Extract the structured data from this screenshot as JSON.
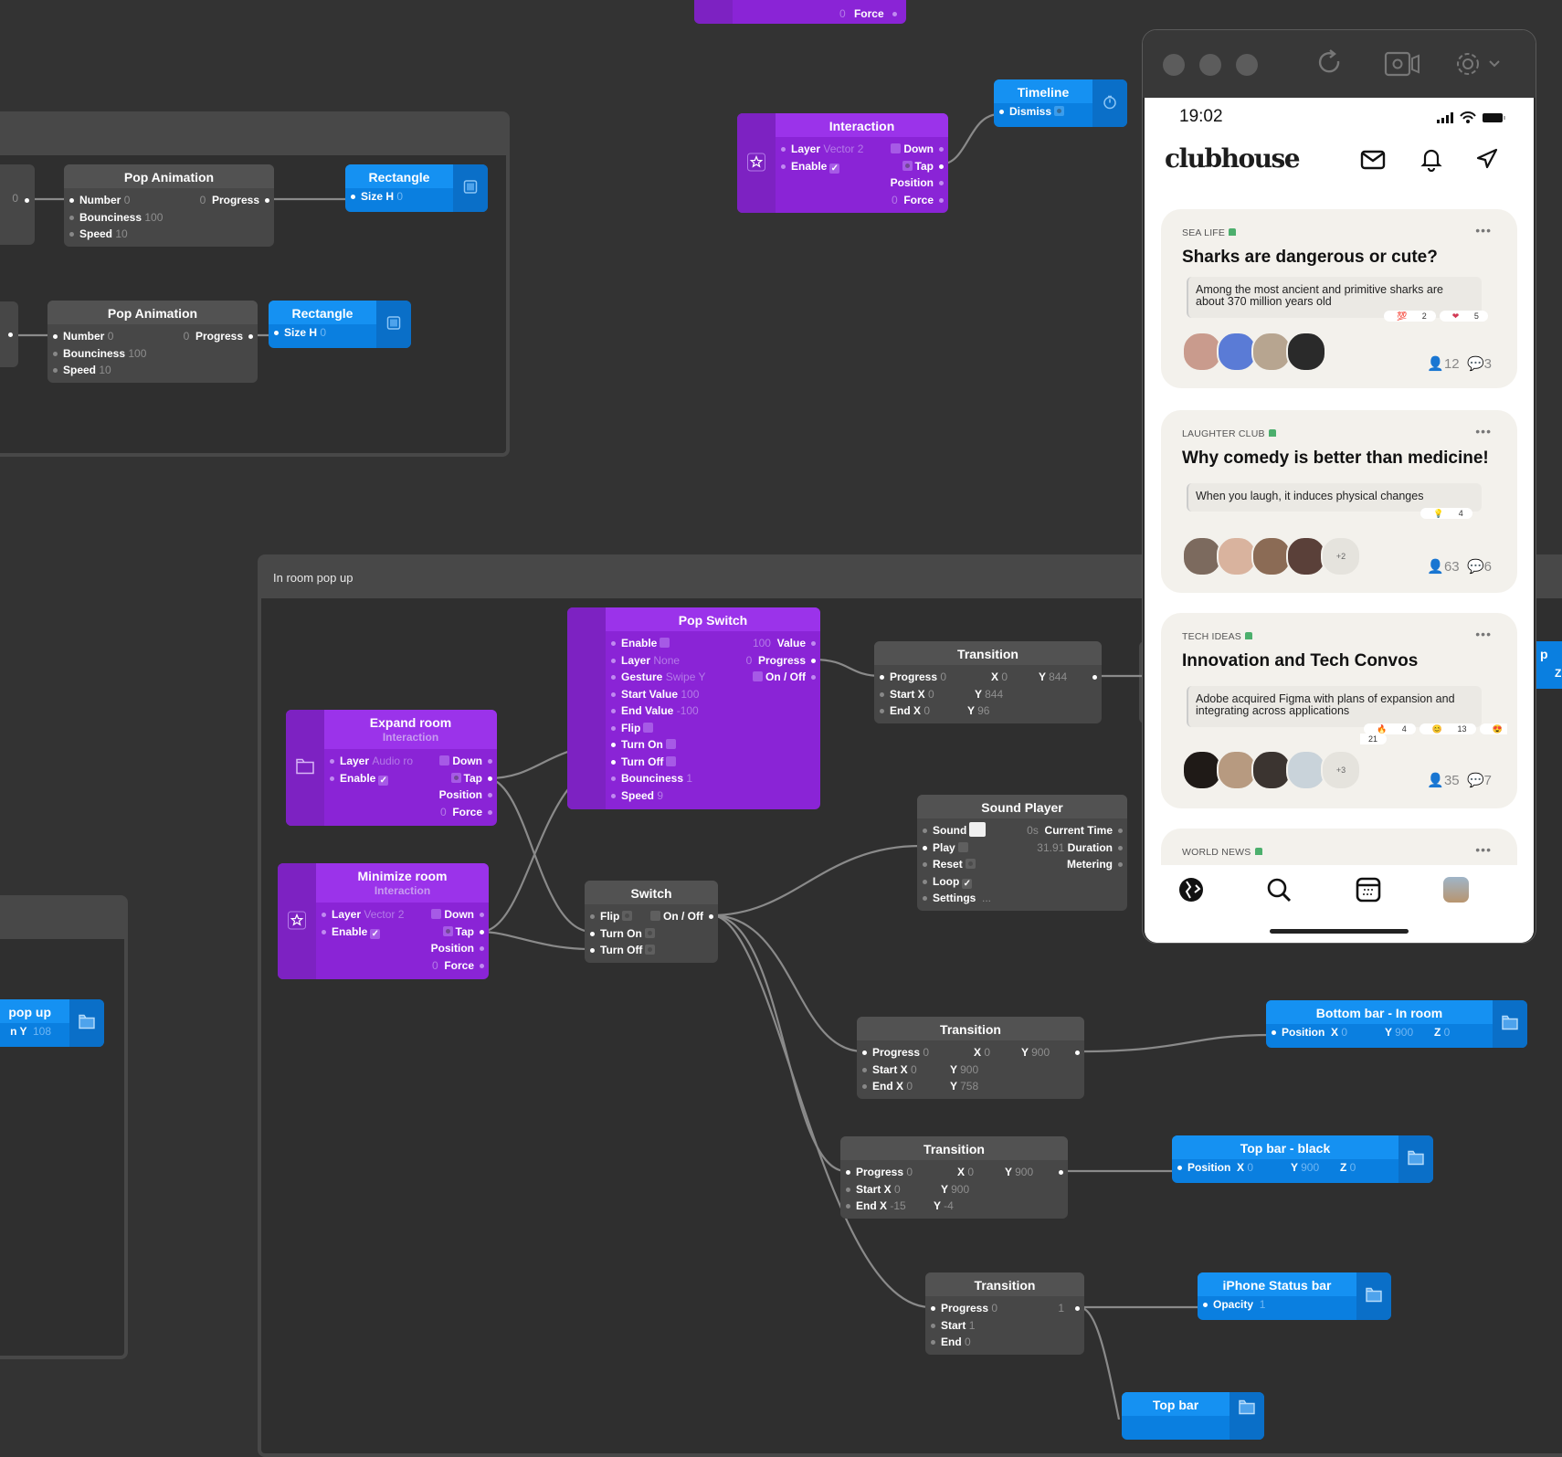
{
  "canvas": {
    "frames": [
      {
        "id": "frame-top",
        "title": ""
      },
      {
        "id": "frame-in-room",
        "title": "In room pop up"
      },
      {
        "id": "frame-left",
        "title": ""
      }
    ],
    "nodes": {
      "top_partial": {
        "force_label": "Force",
        "force_value": "0"
      },
      "left_partial_1": {
        "value": "0"
      },
      "pop_animation_1": {
        "title": "Pop Animation",
        "inputs": [
          {
            "label": "Number",
            "value": "0"
          },
          {
            "label": "Bounciness",
            "value": "100"
          },
          {
            "label": "Speed",
            "value": "10"
          }
        ],
        "output": {
          "label": "Progress",
          "value": "0"
        }
      },
      "rectangle_1": {
        "title": "Rectangle",
        "input": {
          "label": "Size H",
          "value": "0"
        }
      },
      "pop_animation_2": {
        "title": "Pop Animation",
        "inputs": [
          {
            "label": "Number",
            "value": "0"
          },
          {
            "label": "Bounciness",
            "value": "100"
          },
          {
            "label": "Speed",
            "value": "10"
          }
        ],
        "output": {
          "label": "Progress",
          "value": "0"
        }
      },
      "rectangle_2": {
        "title": "Rectangle",
        "input": {
          "label": "Size H",
          "value": "0"
        }
      },
      "interaction_top": {
        "title": "Interaction",
        "layer_label": "Layer",
        "layer_value": "Vector 2",
        "enable_label": "Enable",
        "down_label": "Down",
        "tap_label": "Tap",
        "position_label": "Position",
        "force_label": "Force",
        "force_value": "0"
      },
      "timeline": {
        "title": "Timeline",
        "input": {
          "label": "Dismiss"
        }
      },
      "pop_switch": {
        "title": "Pop Switch",
        "inputs": [
          {
            "label": "Enable",
            "value": ""
          },
          {
            "label": "Layer",
            "value": "None"
          },
          {
            "label": "Gesture",
            "value": "Swipe Y"
          },
          {
            "label": "Start Value",
            "value": "100"
          },
          {
            "label": "End Value",
            "value": "-100"
          },
          {
            "label": "Flip",
            "value": ""
          },
          {
            "label": "Turn On",
            "value": ""
          },
          {
            "label": "Turn Off",
            "value": ""
          },
          {
            "label": "Bounciness",
            "value": "1"
          },
          {
            "label": "Speed",
            "value": "9"
          }
        ],
        "outputs": [
          {
            "label": "Value",
            "value": "100"
          },
          {
            "label": "Progress",
            "value": "0"
          },
          {
            "label": "On / Off",
            "value": ""
          }
        ]
      },
      "expand_room": {
        "title": "Expand room",
        "subtitle": "Interaction",
        "layer_label": "Layer",
        "layer_value": "Audio ro",
        "enable_label": "Enable",
        "down_label": "Down",
        "tap_label": "Tap",
        "position_label": "Position",
        "force_label": "Force",
        "force_value": "0"
      },
      "minimize_room": {
        "title": "Minimize room",
        "subtitle": "Interaction",
        "layer_label": "Layer",
        "layer_value": "Vector 2",
        "enable_label": "Enable",
        "down_label": "Down",
        "tap_label": "Tap",
        "position_label": "Position",
        "force_label": "Force",
        "force_value": "0"
      },
      "transition_1": {
        "title": "Transition",
        "progress_label": "Progress",
        "progress_value": "0",
        "out_x": "0",
        "out_y": "844",
        "start_label": "Start",
        "start_x": "0",
        "start_y": "844",
        "end_label": "End",
        "end_x": "0",
        "end_y": "96"
      },
      "switch": {
        "title": "Switch",
        "flip_label": "Flip",
        "onoff_label": "On / Off",
        "turn_on_label": "Turn On",
        "turn_off_label": "Turn Off"
      },
      "sound_player": {
        "title": "Sound Player",
        "inputs": [
          {
            "label": "Sound"
          },
          {
            "label": "Play"
          },
          {
            "label": "Reset"
          },
          {
            "label": "Loop"
          },
          {
            "label": "Settings",
            "value": "..."
          }
        ],
        "outputs": [
          {
            "label": "Current Time",
            "value": "0s"
          },
          {
            "label": "Duration",
            "value": "31.91"
          },
          {
            "label": "Metering",
            "value": ""
          }
        ]
      },
      "transition_2": {
        "title": "Transition",
        "progress_label": "Progress",
        "progress_value": "0",
        "out_x": "0",
        "out_y": "900",
        "start_label": "Start",
        "start_x": "0",
        "start_y": "900",
        "end_label": "End",
        "end_x": "0",
        "end_y": "758"
      },
      "bottom_bar_in_room": {
        "title": "Bottom bar - In room",
        "label": "Position",
        "x": "0",
        "y": "900",
        "z": "0"
      },
      "transition_3": {
        "title": "Transition",
        "progress_label": "Progress",
        "progress_value": "0",
        "out_x": "0",
        "out_y": "900",
        "start_label": "Start",
        "start_x": "0",
        "start_y": "900",
        "end_label": "End",
        "end_x": "-15",
        "end_y": "-4"
      },
      "top_bar_black": {
        "title": "Top bar - black",
        "label": "Position",
        "x": "0",
        "y": "900",
        "z": "0"
      },
      "transition_4": {
        "title": "Transition",
        "progress_label": "Progress",
        "progress_value": "0",
        "out_value": "1",
        "start_label": "Start",
        "start_value": "1",
        "end_label": "End",
        "end_value": "0"
      },
      "iphone_status_bar": {
        "title": "iPhone Status bar",
        "label": "Opacity",
        "value": "1"
      },
      "top_bar": {
        "title": "Top bar"
      },
      "left_popup": {
        "title": "pop up",
        "row": "n Y",
        "value": "108"
      },
      "right_partial": {
        "title": "p",
        "row": "Z"
      }
    }
  },
  "viewer": {
    "toolbar": {
      "refresh": "refresh-icon",
      "record": "record-icon",
      "settings": "gear-icon"
    },
    "status_bar": {
      "time": "19:02"
    },
    "app": {
      "logo": "clubhouse",
      "rooms": [
        {
          "club": "SEA LIFE",
          "title": "Sharks are dangerous or cute?",
          "quote": "Among the most ancient and primitive sharks are about 370 million years old",
          "reactions": [
            {
              "emoji": "💯",
              "count": "2"
            },
            {
              "emoji": "❤",
              "count": "5"
            }
          ],
          "extra_avatars": "",
          "listeners": "12",
          "comments": "3"
        },
        {
          "club": "LAUGHTER CLUB",
          "title": "Why comedy is better than medicine!",
          "quote": "When you laugh, it induces physical changes",
          "reactions": [
            {
              "emoji": "💡",
              "count": "4"
            }
          ],
          "extra_avatars": "+2",
          "listeners": "63",
          "comments": "6"
        },
        {
          "club": "TECH IDEAS",
          "title": "Innovation and Tech Convos",
          "quote": "Adobe acquired Figma with plans of expansion and integrating across applications",
          "reactions": [
            {
              "emoji": "🔥",
              "count": "4"
            },
            {
              "emoji": "😊",
              "count": "13"
            },
            {
              "emoji": "😍",
              "count": "21"
            }
          ],
          "extra_avatars": "+3",
          "listeners": "35",
          "comments": "7"
        },
        {
          "club": "WORLD NEWS"
        }
      ],
      "more_label": "•••",
      "tabs": [
        "explore",
        "search",
        "calendar",
        "profile"
      ]
    }
  }
}
